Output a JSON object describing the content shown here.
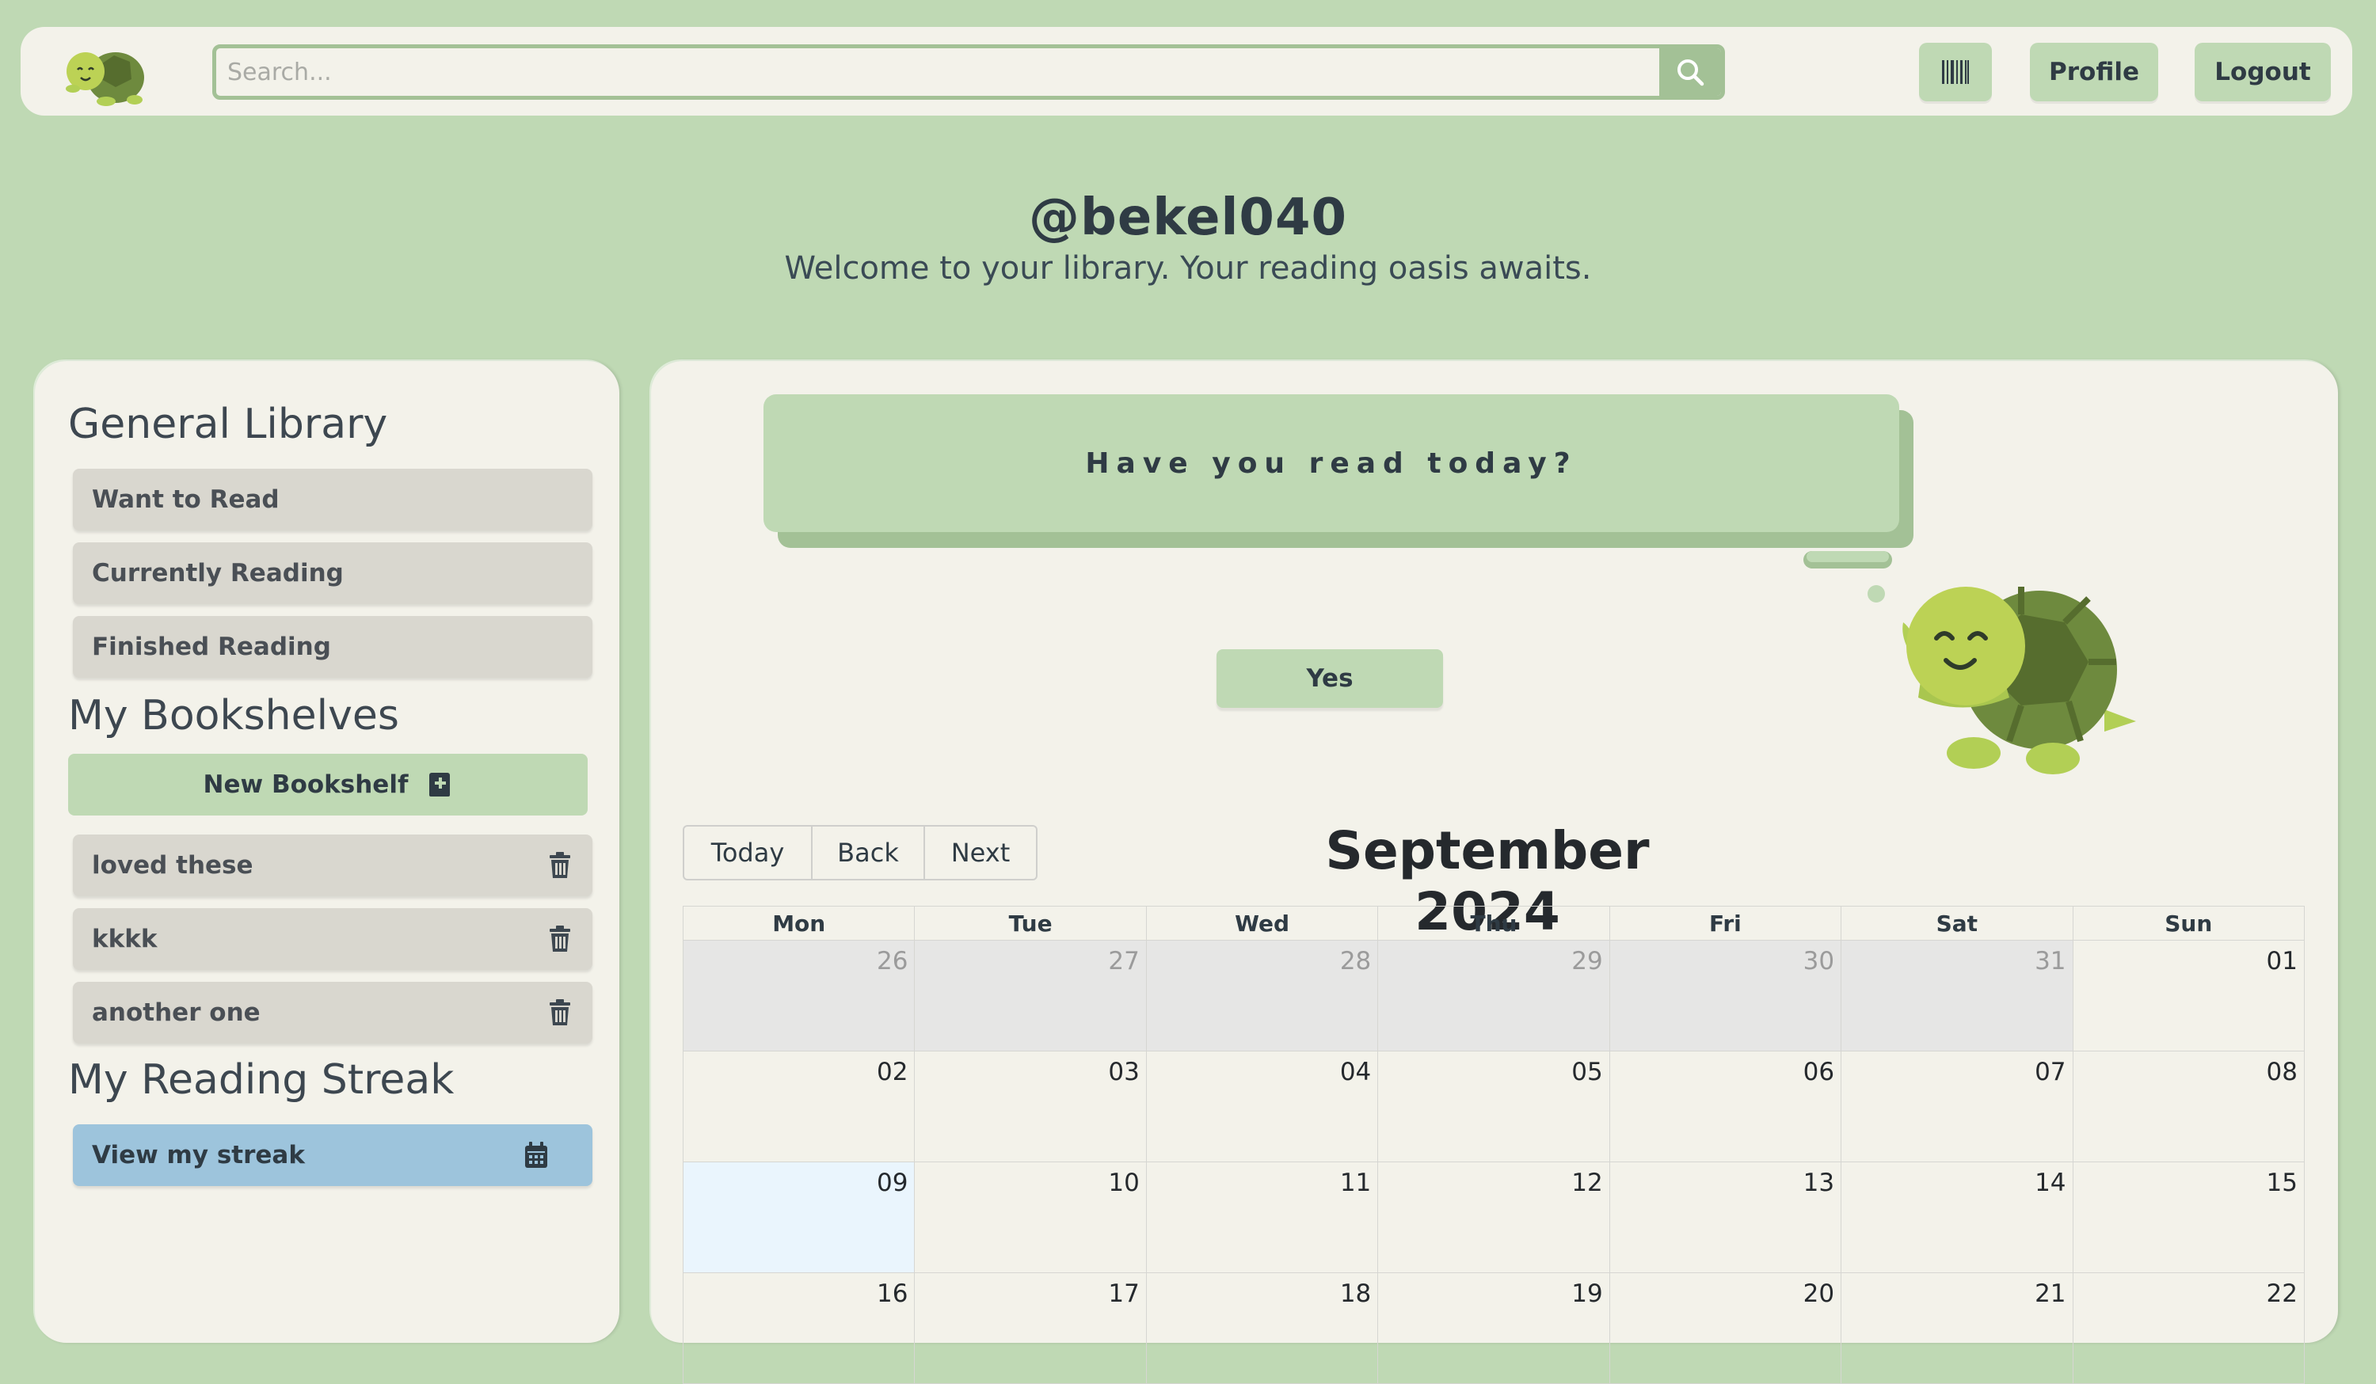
{
  "header": {
    "logo_icon": "turtle-logo-icon",
    "search_placeholder": "Search...",
    "search_icon": "search-icon",
    "barcode_icon": "barcode-icon",
    "profile_label": "Profile",
    "logout_label": "Logout"
  },
  "greeting": {
    "username": "@bekel040",
    "welcome": "Welcome to your library. Your reading oasis awaits."
  },
  "sidebar": {
    "general_heading": "General Library",
    "general_items": [
      "Want to Read",
      "Currently Reading",
      "Finished Reading"
    ],
    "bookshelves_heading": "My Bookshelves",
    "new_bookshelf_label": "New Bookshelf",
    "bookshelves": [
      "loved these",
      "kkkk",
      "another one"
    ],
    "streak_heading": "My Reading Streak",
    "streak_button_label": "View my streak"
  },
  "main": {
    "question": "Have you read today?",
    "yes_label": "Yes",
    "calendar": {
      "today_label": "Today",
      "back_label": "Back",
      "next_label": "Next",
      "title": "September 2024",
      "weekdays": [
        "Mon",
        "Tue",
        "Wed",
        "Thu",
        "Fri",
        "Sat",
        "Sun"
      ],
      "weeks": [
        [
          "26",
          "27",
          "28",
          "29",
          "30",
          "31",
          "01"
        ],
        [
          "02",
          "03",
          "04",
          "05",
          "06",
          "07",
          "08"
        ],
        [
          "09",
          "10",
          "11",
          "12",
          "13",
          "14",
          "15"
        ],
        [
          "16",
          "17",
          "18",
          "19",
          "20",
          "21",
          "22"
        ]
      ]
    }
  },
  "colors": {
    "background": "#bfd9b4",
    "panel": "#f3f2ea",
    "accent_green": "#a3c196",
    "item_gray": "#d9d7cf",
    "streak_blue": "#9dc4dc",
    "today_cell": "#eaf5fd"
  }
}
